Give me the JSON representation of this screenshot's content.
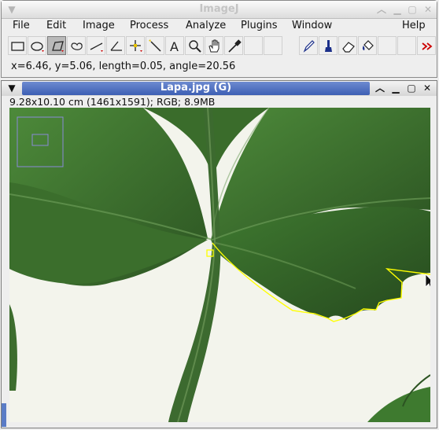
{
  "main_window": {
    "title": "ImageJ",
    "menus": [
      "File",
      "Edit",
      "Image",
      "Process",
      "Analyze",
      "Plugins",
      "Window",
      "Help"
    ],
    "tools": [
      "rectangle-tool-icon",
      "oval-tool-icon",
      "polygon-tool-icon",
      "freehand-tool-icon",
      "line-tool-icon",
      "angle-tool-icon",
      "point-tool-icon",
      "wand-tool-icon",
      "text-tool-icon",
      "magnifier-tool-icon",
      "hand-tool-icon",
      "dropper-tool-icon",
      "blank-slot",
      "pencil-tool-icon",
      "brush-tool-icon",
      "eraser-tool-icon",
      "flood-fill-tool-icon",
      "blank-slot",
      "blank-slot",
      "more-tools-icon"
    ],
    "selected_tool": "polygon-tool-icon",
    "status": "x=6.46, y=5.06, length=0.05, angle=20.56"
  },
  "image_window": {
    "title": "Lapa.jpg (G)",
    "info": "9.28x10.10 cm (1461x1591); RGB; 8.9MB"
  },
  "colors": {
    "title_active": "#4a68bb",
    "selection": "#ffff00",
    "leaf_dark": "#2f5a24",
    "leaf_light": "#4f8a39",
    "background": "#f3f4ec",
    "navigator": "#8a8ad8"
  }
}
